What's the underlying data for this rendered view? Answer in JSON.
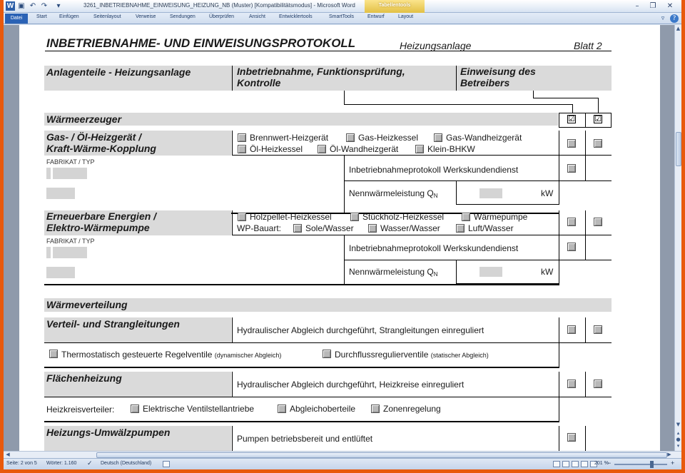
{
  "window": {
    "title": "3261_INBETRIEBNAHME_EINWEISUNG_HEIZUNG_NB (Muster) [Kompatibilitätsmodus] - Microsoft Word",
    "context_tab": "Tabellentools"
  },
  "ribbon": {
    "tabs": [
      "Datei",
      "Start",
      "Einfügen",
      "Seitenlayout",
      "Verweise",
      "Sendungen",
      "Überprüfen",
      "Ansicht",
      "Entwicklertools",
      "SmartTools",
      "Entwurf",
      "Layout"
    ]
  },
  "form": {
    "title": "INBETRIEBNAHME-  UND EINWEISUNGSPROTOKOLL",
    "subtitle": "Heizungsanlage",
    "sheet": "Blatt 2",
    "col_headers": {
      "components": "Anlagenteile - Heizungsanlage",
      "commissioning_l1": "Inbetriebnahme, Funktionsprüfung,",
      "commissioning_l2": "Kontrolle",
      "instruction_l1": "Einweisung des",
      "instruction_l2": "Betreibers"
    },
    "header_checks": [
      "☑",
      "☑"
    ],
    "section_heat_generator": "Wärmeerzeuger",
    "gas_oil": {
      "title_l1": "Gas- / Öl-Heizgerät /",
      "title_l2": "Kraft-Wärme-Kopplung",
      "options_row1": [
        "Brennwert-Heizgerät",
        "Gas-Heizkessel",
        "Gas-Wandheizgerät"
      ],
      "options_row2": [
        "Öl-Heizkessel",
        "Öl-Wandheizgerät",
        "Klein-BHKW"
      ],
      "make_label": "FABRIKAT / TYP",
      "protocol_label": "Inbetriebnahmeprotokoll Werkskundendienst",
      "power_label": "Nennwärmeleistung Q",
      "power_sub": "N",
      "power_unit": "kW"
    },
    "renewable": {
      "title_l1": "Erneuerbare Energien /",
      "title_l2": "Elektro-Wärmepumpe",
      "options_row1": [
        "Holzpellet-Heizkessel",
        "Stückholz-Heizkessel",
        "Wärmepumpe"
      ],
      "wp_label": "WP-Bauart:",
      "options_row2": [
        "Sole/Wasser",
        "Wasser/Wasser",
        "Luft/Wasser"
      ],
      "make_label": "FABRIKAT / TYP",
      "protocol_label": "Inbetriebnahmeprotokoll Werkskundendienst",
      "power_label": "Nennwärmeleistung Q",
      "power_sub": "N",
      "power_unit": "kW"
    },
    "section_distribution": "Wärmeverteilung",
    "pipes": {
      "title": "Verteil- und Strangleitungen",
      "task": "Hydraulischer Abgleich durchgeführt, Strangleitungen einreguliert",
      "valve1": "Thermostatisch gesteuerte Regelventile",
      "valve1_note": "(dynamischer Abgleich)",
      "valve2": "Durchflussregulierventile",
      "valve2_note": "(statischer Abgleich)"
    },
    "floor": {
      "title": "Flächenheizung",
      "task": "Hydraulischer Abgleich durchgeführt, Heizkreise einreguliert",
      "distributor_label": "Heizkreisverteiler:",
      "options": [
        "Elektrische Ventilstellantriebe",
        "Abgleichoberteile",
        "Zonenregelung"
      ]
    },
    "pumps": {
      "title": "Heizungs-Umwälzpumpen",
      "task": "Pumpen betriebsbereit und entlüftet"
    }
  },
  "status": {
    "page": "Seite: 2 von 5",
    "words": "Wörter: 1.160",
    "language": "Deutsch (Deutschland)",
    "zoom": "201 %"
  }
}
